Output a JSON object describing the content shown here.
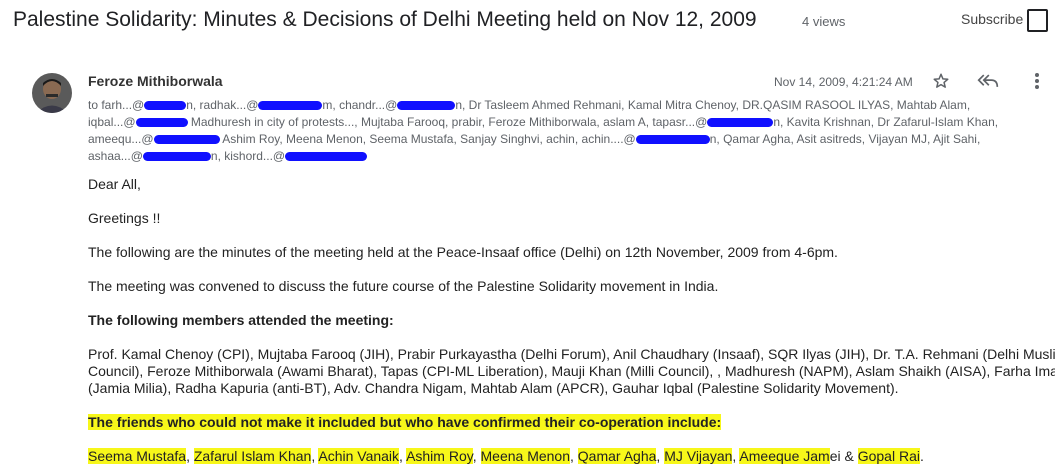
{
  "header": {
    "title": "Palestine Solidarity: Minutes & Decisions of Delhi Meeting held on Nov 12, 2009",
    "views": "4 views",
    "subscribe_label": "Subscribe"
  },
  "message": {
    "author": "Feroze Mithiborwala",
    "date": "Nov 14, 2009, 4:21:24 AM",
    "recipients": {
      "line1_a": "to farh...@",
      "line1_b": "n, radhak...@",
      "line1_c": "m, chandr...@",
      "line1_d": "n, Dr Tasleem Ahmed Rehmani, Kamal Mitra Chenoy, DR.QASIM RASOOL ILYAS, Mahtab Alam,",
      "line2_a": "iqbal...@",
      "line2_b": "Madhuresh in city of protests..., Mujtaba Farooq, prabir, Feroze Mithiborwala, aslam A, tapasr...@",
      "line2_c": "n, Kavita Krishnan, Dr Zafarul-Islam Khan,",
      "line3_a": "ameequ...@",
      "line3_b": "Ashim Roy, Meena Menon, Seema Mustafa, Sanjay Singhvi, achin, achin....@",
      "line3_c": "n, Qamar Agha, Asit asitreds, Vijayan MJ, Ajit Sahi,",
      "line4_a": "ashaa...@",
      "line4_b": "n, kishord...@"
    },
    "greeting": "Dear All,",
    "greetings2": "Greetings !!",
    "para1": "The following are the minutes of the meeting held at the Peace-Insaaf office (Delhi) on 12th November, 2009 from 4-6pm.",
    "para2": "The meeting was convened to discuss the future course of the Palestine Solidarity movement in India.",
    "members_heading": "The following members attended the meeting:",
    "members_line1": "Prof. Kamal Chenoy (CPI), Mujtaba Farooq (JIH), Prabir Purkayastha (Delhi Forum), Anil Chaudhary (Insaaf), SQR Ilyas (JIH), Dr. T.A. Rehmani (Delhi Muslim",
    "members_line2": "Council), Feroze Mithiborwala (Awami Bharat), Tapas (CPI-ML Liberation), Mauji Khan (Milli Council), , Madhuresh (NAPM), Aslam Shaikh (AISA), Farha Iman",
    "members_line3": "(Jamia Milia), Radha Kapuria (anti-BT), Adv. Chandra Nigam, Mahtab Alam (APCR), Gauhar Iqbal (Palestine Solidarity Movement).",
    "friends_heading": "The friends who could not make it included but who have confirmed their co-operation include:",
    "friends": {
      "n1": "Seema Mustafa",
      "n2": "Zafarul Islam Khan",
      "n3": "Achin Vanaik",
      "n4": "Ashim Roy",
      "n5": "Meena Menon",
      "n6": "Qamar Agha",
      "n7": "MJ Vijayan",
      "n8a": "Ameeque Jam",
      "n8b": "ei & ",
      "n9": "Gopal Rai",
      "end": "."
    }
  },
  "icons": [
    "star-icon",
    "reply-all-icon",
    "more-vert-icon"
  ],
  "colors": {
    "highlight": "#f7f71a",
    "redaction": "#1010ff"
  }
}
